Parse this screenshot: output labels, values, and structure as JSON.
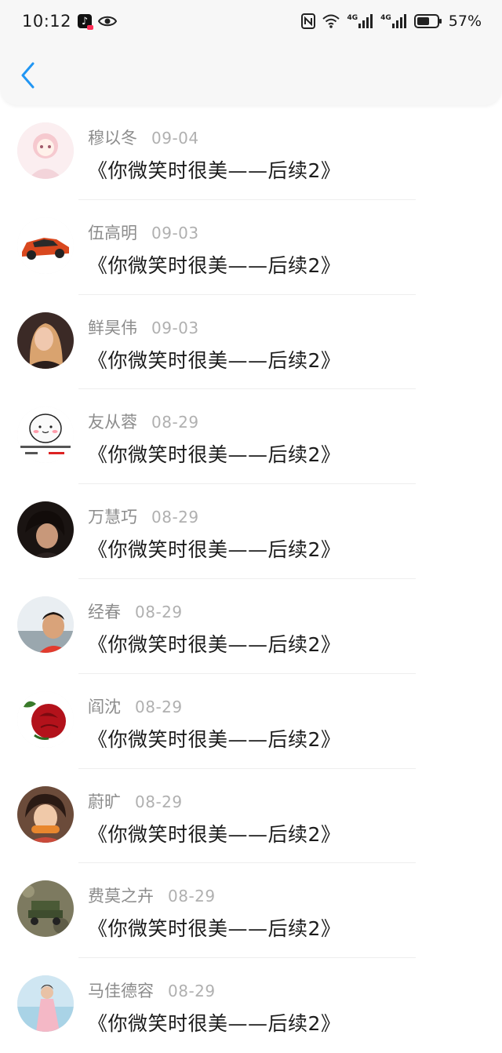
{
  "status_bar": {
    "time": "10:12",
    "battery_percent": "57%",
    "network_1": "4G",
    "network_2": "4G"
  },
  "nav": {
    "back_icon": "chevron-left-icon",
    "accent": "#2196f3"
  },
  "items": [
    {
      "name": "穆以冬",
      "date": "09-04",
      "title": "《你微笑时很美——后续2》"
    },
    {
      "name": "伍高明",
      "date": "09-03",
      "title": "《你微笑时很美——后续2》"
    },
    {
      "name": "鲜昊伟",
      "date": "09-03",
      "title": "《你微笑时很美——后续2》"
    },
    {
      "name": "友从蓉",
      "date": "08-29",
      "title": "《你微笑时很美——后续2》"
    },
    {
      "name": "万慧巧",
      "date": "08-29",
      "title": "《你微笑时很美——后续2》"
    },
    {
      "name": "经春",
      "date": "08-29",
      "title": "《你微笑时很美——后续2》"
    },
    {
      "name": "阎沈",
      "date": "08-29",
      "title": "《你微笑时很美——后续2》"
    },
    {
      "name": "蔚旷",
      "date": "08-29",
      "title": "《你微笑时很美——后续2》"
    },
    {
      "name": "费莫之卉",
      "date": "08-29",
      "title": "《你微笑时很美——后续2》"
    },
    {
      "name": "马佳德容",
      "date": "08-29",
      "title": "《你微笑时很美——后续2》"
    }
  ]
}
